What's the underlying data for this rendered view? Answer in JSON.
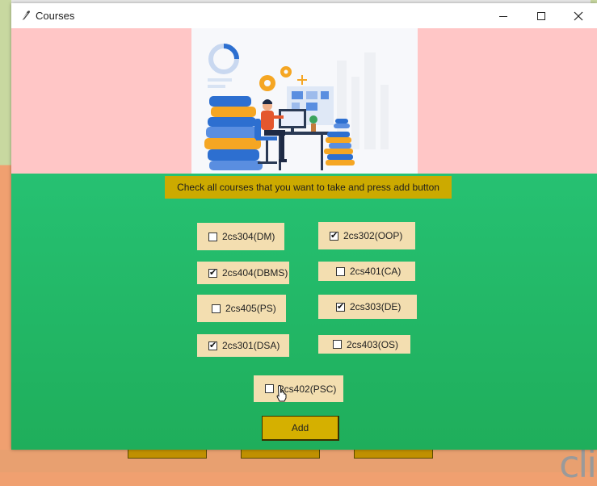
{
  "window": {
    "title": "Courses",
    "app_icon": "feather-icon",
    "controls": [
      "minimize-icon",
      "maximize-icon",
      "close-icon"
    ]
  },
  "instruction": "Check all courses that you want to take and press add button",
  "courses": [
    {
      "label": "2cs304(DM)",
      "checked": false
    },
    {
      "label": "2cs302(OOP)",
      "checked": true
    },
    {
      "label": "2cs404(DBMS)",
      "checked": true
    },
    {
      "label": "2cs401(CA)",
      "checked": false
    },
    {
      "label": "2cs405(PS)",
      "checked": false
    },
    {
      "label": "2cs303(DE)",
      "checked": true
    },
    {
      "label": "2cs301(DSA)",
      "checked": true
    },
    {
      "label": "2cs403(OS)",
      "checked": false
    },
    {
      "label": "2cs402(PSC)",
      "checked": false
    }
  ],
  "add_button": "Add",
  "colors": {
    "header_bg": "#ffc6c6",
    "body_bg": "#22b866",
    "instruction_bg": "#ccaa00",
    "checkbox_bg": "#f3deb0",
    "button_bg": "#d5b000"
  }
}
